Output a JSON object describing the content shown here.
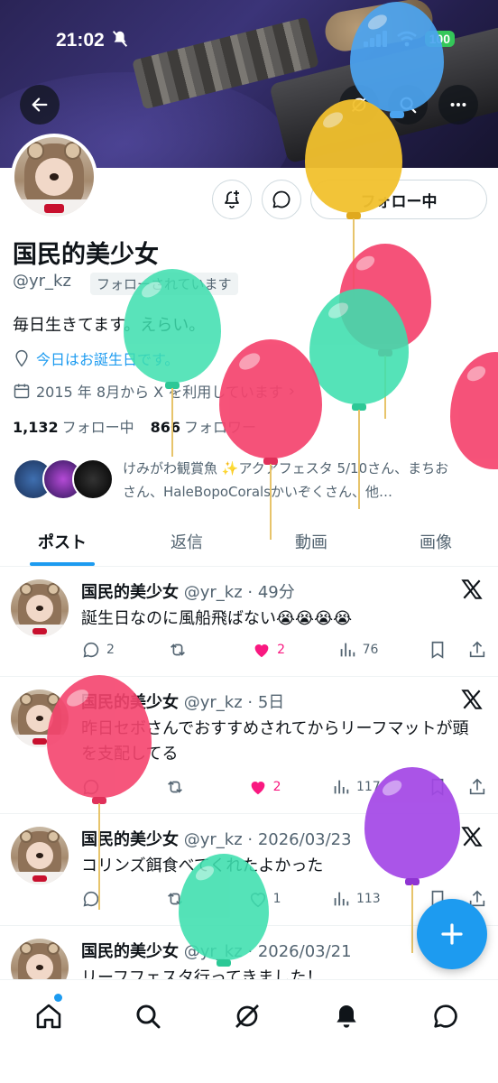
{
  "status_bar": {
    "time": "21:02",
    "battery": "100"
  },
  "profile": {
    "name": "国民的美少女",
    "handle": "@yr_kz",
    "follows_you": "フォローされています",
    "bio": "毎日生きてます。えらい。",
    "birthday": "今日はお誕生日です。",
    "joined": "2015 年 8月から X を利用しています",
    "following_count": "1,132",
    "following_label": "フォロー中",
    "followers_count": "866",
    "followers_label": "フォロワー",
    "follow_button": "フォロー中",
    "followed_by_text": "けみがわ観賞魚 ✨アクアフェスタ 5/10さん、まちおさん、HaleBopoCoralsかいぞくさん、他…"
  },
  "tabs": [
    {
      "label": "ポスト",
      "active": true
    },
    {
      "label": "返信",
      "active": false
    },
    {
      "label": "動画",
      "active": false
    },
    {
      "label": "画像",
      "active": false
    }
  ],
  "posts": [
    {
      "name": "国民的美少女",
      "meta": "@yr_kz · 49分",
      "text": "誕生日なのに風船飛ばない😭😭😭😭",
      "replies": "2",
      "reposts": "",
      "likes": "2",
      "liked": true,
      "views": "76"
    },
    {
      "name": "国民的美少女",
      "meta": "@yr_kz · 5日",
      "text": "昨日セボさんでおすすめされてからリーフマットが頭を支配してる",
      "replies": "",
      "reposts": "",
      "likes": "2",
      "liked": true,
      "views": "117"
    },
    {
      "name": "国民的美少女",
      "meta": "@yr_kz · 2026/03/23",
      "text": "コリンズ餌食べてくれたよかった",
      "replies": "",
      "reposts": "",
      "likes": "1",
      "liked": false,
      "views": "113"
    },
    {
      "name": "国民的美少女",
      "meta": "@yr_kz · 2026/03/21",
      "text": "リーフフェスタ行ってきました！",
      "replies": "",
      "reposts": "",
      "likes": "",
      "liked": false,
      "views": ""
    }
  ],
  "colors": {
    "accent": "#1d9bf0",
    "like": "#f91880",
    "balloon_red": "#f5446e",
    "balloon_green": "#3ddfae",
    "balloon_yellow": "#f2c12e",
    "balloon_blue": "#4ca4f0",
    "balloon_purple": "#a346e6"
  },
  "icons": [
    "back-arrow-icon",
    "grok-icon",
    "search-icon",
    "more-icon",
    "bell-plus-icon",
    "message-icon",
    "location-icon",
    "calendar-icon",
    "x-logo-icon",
    "reply-icon",
    "repost-icon",
    "like-icon",
    "views-icon",
    "bookmark-icon",
    "share-icon",
    "plus-icon",
    "home-icon",
    "communities-icon",
    "notifications-icon",
    "messages-icon"
  ]
}
